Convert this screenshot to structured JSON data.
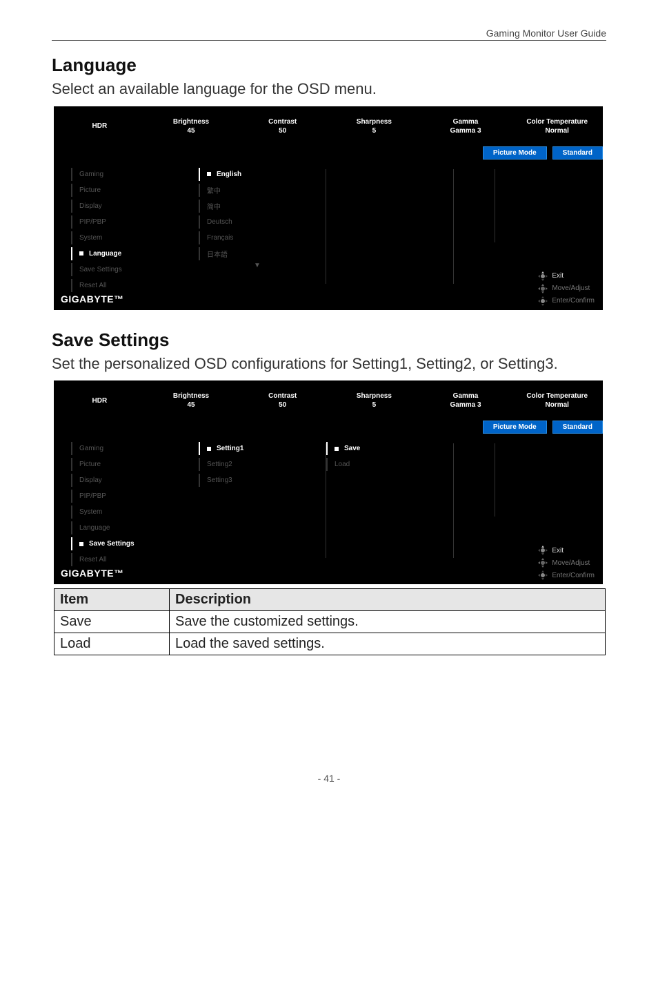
{
  "header": {
    "guide_title": "Gaming Monitor User Guide"
  },
  "section_language": {
    "title": "Language",
    "desc": "Select an available language for the OSD menu."
  },
  "section_save": {
    "title": "Save Settings",
    "desc": "Set the personalized OSD configurations for Setting1, Setting2, or Setting3."
  },
  "osd_top": {
    "hdr": {
      "label": "HDR",
      "value": ""
    },
    "brightness": {
      "label": "Brightness",
      "value": "45"
    },
    "contrast": {
      "label": "Contrast",
      "value": "50"
    },
    "sharpness": {
      "label": "Sharpness",
      "value": "5"
    },
    "gamma": {
      "label": "Gamma",
      "value": "Gamma 3"
    },
    "colortemp": {
      "label": "Color Temperature",
      "value": "Normal"
    }
  },
  "osd_bar": {
    "picture_mode_label": "Picture Mode",
    "picture_mode_value": "Standard"
  },
  "osd_menu1": {
    "left": [
      "Gaming",
      "Picture",
      "Display",
      "PIP/PBP",
      "System",
      "Language",
      "Save Settings",
      "Reset All"
    ],
    "left_active_index": 5,
    "mid": [
      "English",
      "繁中",
      "简中",
      "Deutsch",
      "Français",
      "日本語"
    ],
    "mid_active_index": 0
  },
  "osd_menu2": {
    "left": [
      "Gaming",
      "Picture",
      "Display",
      "PIP/PBP",
      "System",
      "Language",
      "Save Settings",
      "Reset All"
    ],
    "left_active_index": 6,
    "mid": [
      "Setting1",
      "Setting2",
      "Setting3"
    ],
    "mid_active_index": 0,
    "right": [
      "Save",
      "Load"
    ],
    "right_active_index": 0
  },
  "osd_hints": {
    "exit": "Exit",
    "move": "Move/Adjust",
    "enter": "Enter/Confirm"
  },
  "osd_brand": "GIGABYTE™",
  "desc_table": {
    "headers": [
      "Item",
      "Description"
    ],
    "rows": [
      {
        "item": "Save",
        "desc": "Save the customized settings."
      },
      {
        "item": "Load",
        "desc": "Load the saved settings."
      }
    ]
  },
  "page_number": "- 41 -"
}
